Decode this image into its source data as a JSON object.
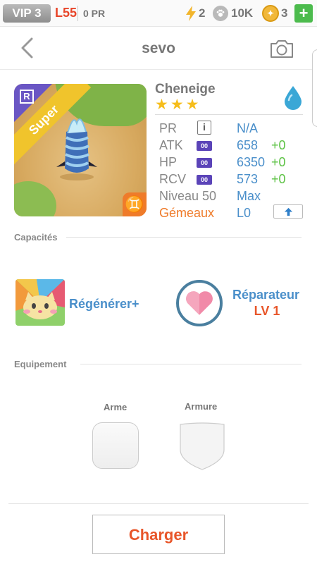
{
  "topbar": {
    "vip": "VIP 3",
    "level": "L55",
    "pr": "0 PR",
    "energy": "2",
    "paws": "10K",
    "coins": "3",
    "plus": "+"
  },
  "header": {
    "title": "sevo",
    "back_icon": "chevron-left-icon",
    "camera_icon": "camera-icon"
  },
  "character": {
    "name": "Cheneige",
    "stars": [
      "★",
      "★",
      "★"
    ],
    "rarity_letter": "R",
    "rank_band": "Super",
    "element": "water",
    "zodiac_symbol": "♊"
  },
  "stats": {
    "pr_label": "PR",
    "pr_info": "i",
    "pr_value": "N/A",
    "atk_label": "ATK",
    "atk_chip": "00",
    "atk_value": "658",
    "atk_bonus": "+0",
    "hp_label": "HP",
    "hp_chip": "00",
    "hp_value": "6350",
    "hp_bonus": "+0",
    "rcv_label": "RCV",
    "rcv_chip": "00",
    "rcv_value": "573",
    "rcv_bonus": "+0",
    "level_label": "Niveau 50",
    "level_value": "Max",
    "zodiac_label": "Gémeaux",
    "zodiac_value": "L0"
  },
  "abilities": {
    "section_title": "Capacités",
    "skill_name": "Régénérer+",
    "leader_name": "Réparateur",
    "leader_level": "LV 1"
  },
  "equipment": {
    "section_title": "Equipement",
    "weapon_label": "Arme",
    "armor_label": "Armure"
  },
  "footer": {
    "charge_button": "Charger"
  },
  "colors": {
    "accent_blue": "#4a8fca",
    "accent_orange": "#e8562a",
    "bonus_green": "#5cc244",
    "star_gold": "#f6bd1b"
  }
}
